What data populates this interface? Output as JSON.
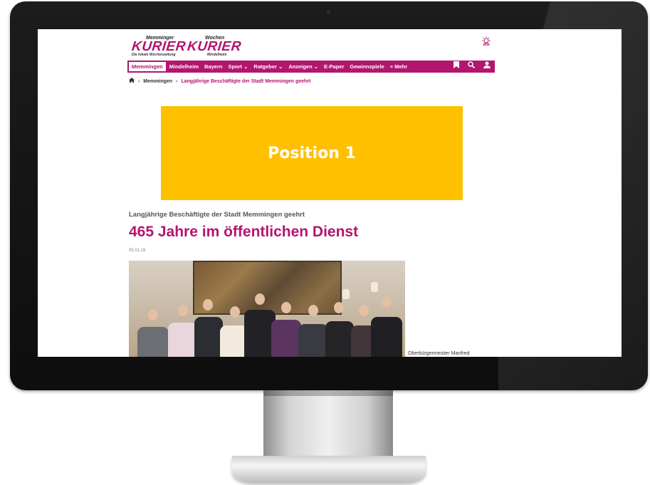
{
  "logo": {
    "line1_small_left": "Memminger",
    "line1_small_right": "Wochen",
    "brand_left": "KURIER",
    "brand_right": "KURIER",
    "sub_left": "Die lokale Wochenzeitung",
    "sub_right": "Mindelheim"
  },
  "weather": {
    "icon": "weather-sun-cloud-icon"
  },
  "nav": {
    "items": [
      {
        "label": "Memmingen",
        "active": true
      },
      {
        "label": "Mindelheim"
      },
      {
        "label": "Bayern"
      },
      {
        "label": "Sport ⌄"
      },
      {
        "label": "Ratgeber ⌄"
      },
      {
        "label": "Anzeigen ⌄"
      },
      {
        "label": "E-Paper"
      },
      {
        "label": "Gewinnspiele"
      },
      {
        "label": "≡ Mehr"
      }
    ],
    "icons": [
      "bookmark-icon",
      "search-icon",
      "user-icon"
    ]
  },
  "breadcrumb": {
    "home_icon": "home-icon",
    "section": "Memmingen",
    "current": "Langjährige Beschäftigte der Stadt Memmingen geehrt"
  },
  "ad": {
    "label": "Position 1",
    "color": "#ffc000"
  },
  "article": {
    "kicker": "Langjährige Beschäftigte der Stadt Memmingen geehrt",
    "headline": "465 Jahre im öffentlichen Dienst",
    "date": "05.01.18",
    "caption": "Oberbürgermeister Manfred"
  },
  "colors": {
    "brand": "#b3156f",
    "ad": "#ffc000"
  }
}
